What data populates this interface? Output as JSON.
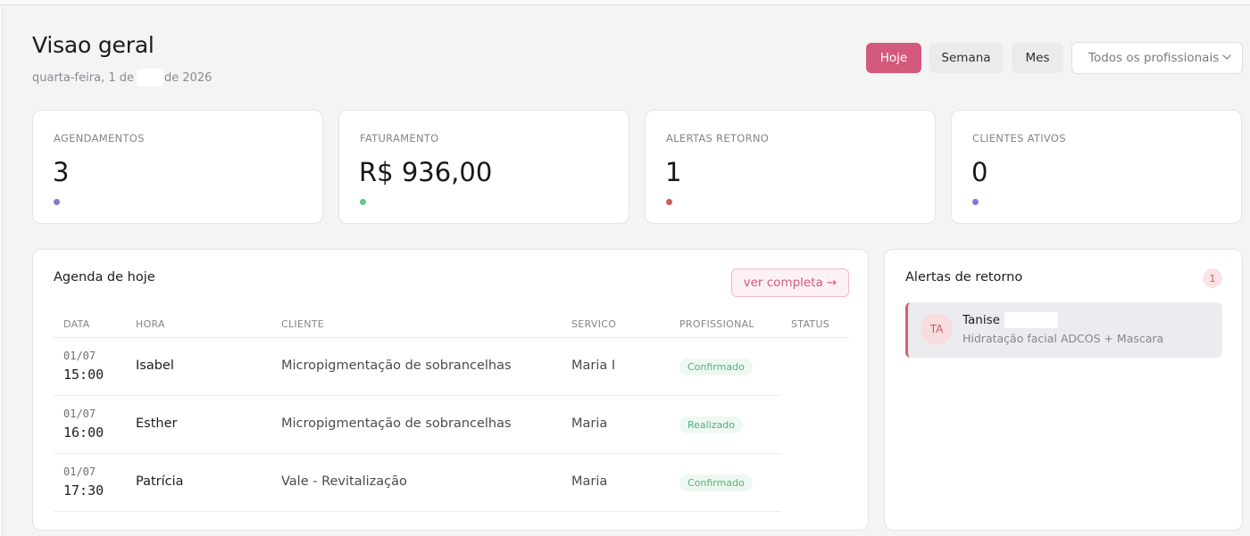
{
  "header": {
    "title": "Visao geral",
    "date_prefix": "quarta-feira, 1 de",
    "date_suffix": "de 2026"
  },
  "period_buttons": {
    "today": "Hoje",
    "week": "Semana",
    "month": "Mes",
    "active": "Hoje"
  },
  "professional_filter": {
    "selected": "Todos os profissionais"
  },
  "stats": [
    {
      "label": "AGENDAMENTOS",
      "value": "3",
      "color": "#8b74d8"
    },
    {
      "label": "FATURAMENTO",
      "value": "R$ 936,00",
      "color": "#5dc98f"
    },
    {
      "label": "ALERTAS RETORNO",
      "value": "1",
      "color": "#d35b5b"
    },
    {
      "label": "CLIENTES ATIVOS",
      "value": "0",
      "color": "#8b74d8"
    }
  ],
  "agenda": {
    "title": "Agenda de hoje",
    "view_full": "ver completa →",
    "columns": [
      "DATA",
      "HORA",
      "CLIENTE",
      "SERVICO",
      "PROFISSIONAL",
      "STATUS"
    ],
    "rows": [
      {
        "date": "01/07",
        "time": "15:00",
        "client": "Isabel",
        "service": "Micropigmentação de sobrancelhas",
        "professional": "Maria I",
        "status": "Confirmado"
      },
      {
        "date": "01/07",
        "time": "16:00",
        "client": "Esther",
        "service": "Micropigmentação de sobrancelhas",
        "professional": "Maria",
        "status": "Realizado"
      },
      {
        "date": "01/07",
        "time": "17:30",
        "client": "Patrícia",
        "service": "Vale - Revitalização",
        "professional": "Maria",
        "status": "Confirmado"
      }
    ]
  },
  "alerts": {
    "title": "Alertas de retorno",
    "count": "1",
    "items": [
      {
        "initials": "TA",
        "name": "Tanise",
        "service": "Hidratação facial ADCOS + Mascara"
      }
    ]
  },
  "colors": {
    "accent": "#d35a7c",
    "status_green": "#4fb37a",
    "alert_red": "#d8606a"
  },
  "icons": {
    "select_arrow": "chevron-down-icon"
  }
}
